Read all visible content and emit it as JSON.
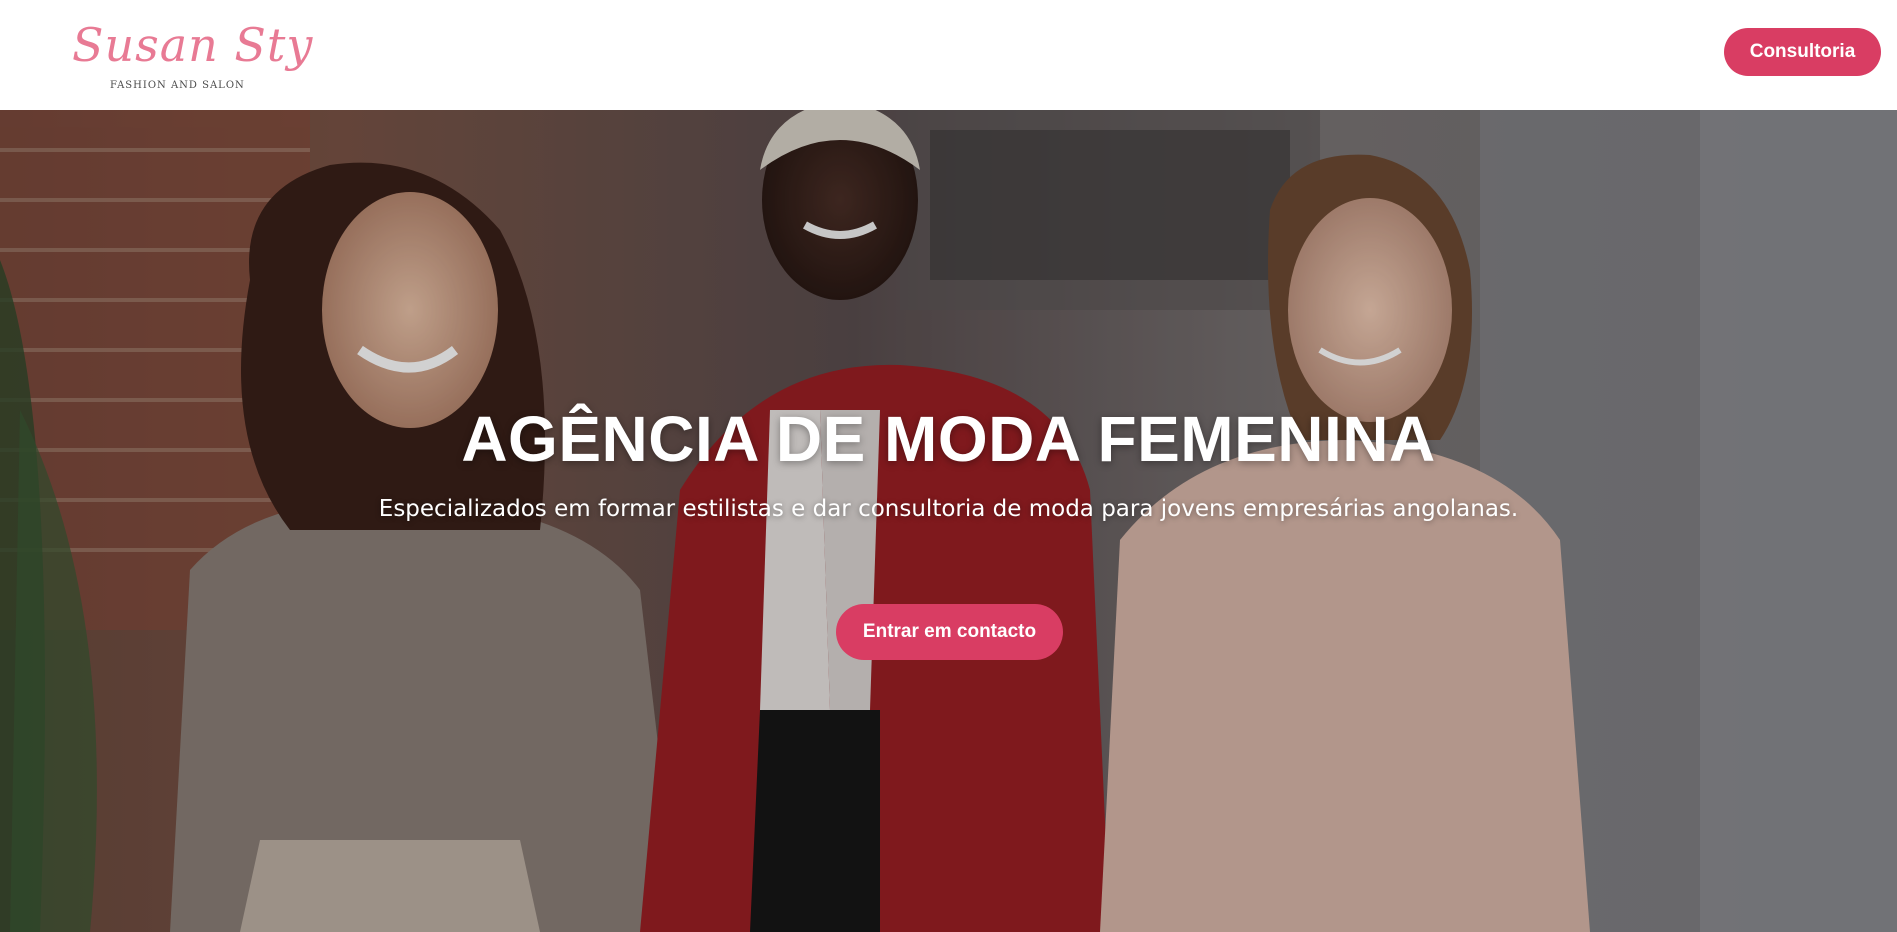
{
  "header": {
    "logo": {
      "script_text": "Susan Sty",
      "tagline": "FASHION AND SALON"
    },
    "cta_label": "Consultoria"
  },
  "hero": {
    "title": "AGÊNCIA DE MODA FEMENINA",
    "subtitle": "Especializados em formar estilistas e dar consultoria de moda para jovens empresárias angolanas.",
    "cta_label": "Entrar em contacto",
    "image_description_icon": "hero-photo-three-women"
  },
  "colors": {
    "accent": "#d93d63",
    "logo_pink": "#e87a94",
    "header_bg": "#ffffff",
    "hero_text": "#ffffff"
  }
}
